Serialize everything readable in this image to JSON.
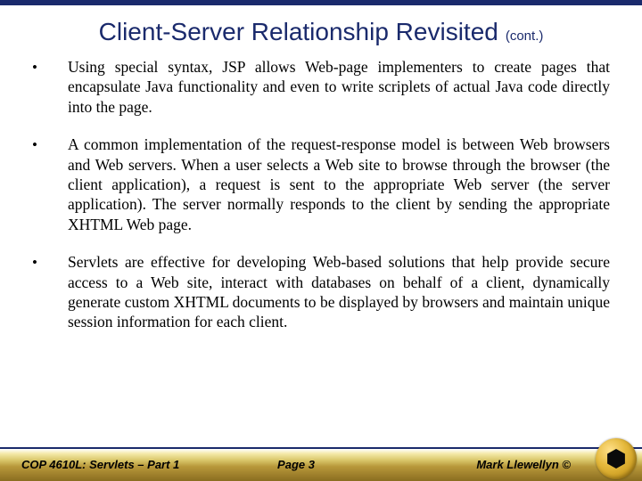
{
  "title": {
    "main": "Client-Server Relationship Revisited",
    "cont": "(cont.)"
  },
  "bullets": [
    "Using special syntax, JSP allows Web-page implementers to create pages that encapsulate Java functionality and even to write scriplets of actual Java code directly into the page.",
    "A common implementation of the request-response model is between Web browsers and Web servers.  When a user selects a Web site to browse through the browser (the client application), a request is sent to the appropriate Web server (the server application).  The server normally responds to the client by sending the appropriate XHTML Web page.",
    "Servlets are effective for developing Web-based solutions that help provide secure access to a Web site, interact with databases on behalf of a client, dynamically generate custom XHTML documents to be displayed by browsers and maintain unique session information for each client."
  ],
  "footer": {
    "left": "COP 4610L: Servlets – Part 1",
    "center": "Page 3",
    "right": "Mark Llewellyn ©"
  }
}
